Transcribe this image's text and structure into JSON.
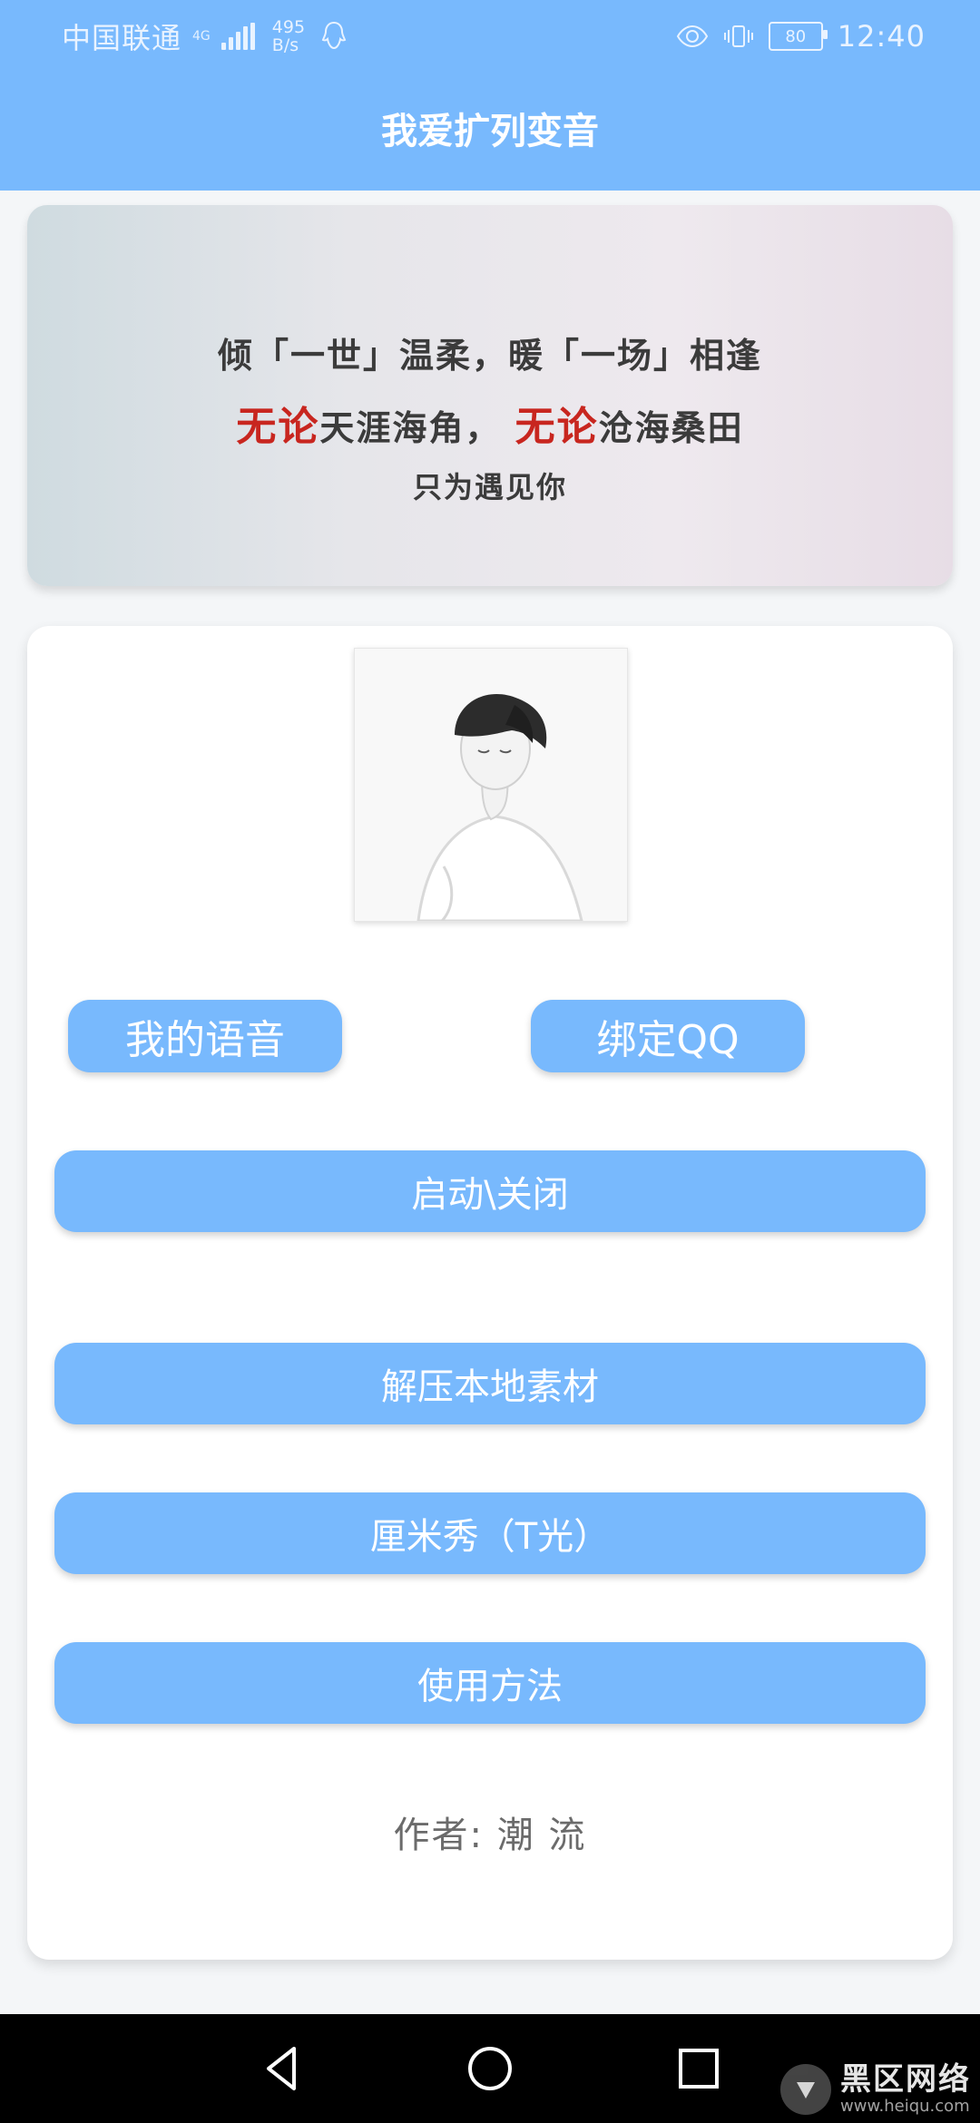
{
  "status_bar": {
    "carrier": "中国联通",
    "network": "4G",
    "speed_value": "495",
    "speed_unit": "B/s",
    "battery": "80",
    "time": "12:40",
    "icons": [
      "signal-icon",
      "qq-icon",
      "eye-icon",
      "vibrate-icon",
      "battery-icon"
    ]
  },
  "app": {
    "title": "我爱扩列变音"
  },
  "banner": {
    "line1": {
      "a": "倾「",
      "b": "一世",
      "c": "」温柔，暖「",
      "d": "一场",
      "e": "」相逢"
    },
    "line2": {
      "r1": "无论",
      "m1": "天涯海角，",
      "r2": "无论",
      "m2": "沧海桑田"
    },
    "line3": "只为遇见你"
  },
  "main": {
    "avatar_icon": "person-illustration",
    "buttons": {
      "my_voice": "我的语音",
      "bind_qq": "绑定QQ",
      "toggle": "启动\\关闭",
      "extract": "解压本地素材",
      "cmshow": "厘米秀（T光）",
      "usage": "使用方法"
    },
    "author": "作者: 潮 流"
  },
  "navbar": {
    "icons": [
      "back-icon",
      "home-icon",
      "recent-apps-icon"
    ]
  },
  "watermark": {
    "title": "黑区网络",
    "site": "www.heiqu.com"
  },
  "colors": {
    "accent": "#78b9fd",
    "red_text": "#c8261f"
  }
}
